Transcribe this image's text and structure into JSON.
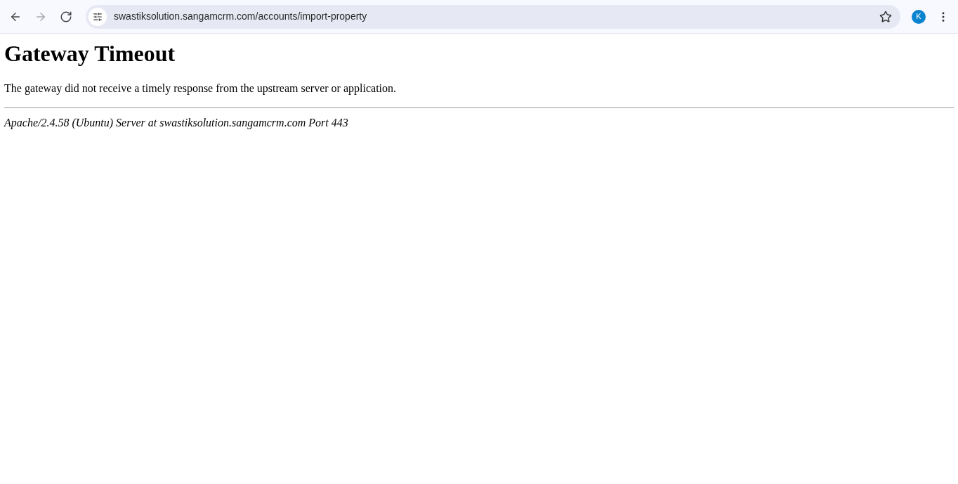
{
  "browser": {
    "nav_buttons": [
      {
        "kind": "back",
        "disabled": false
      },
      {
        "kind": "forward",
        "disabled": true
      },
      {
        "kind": "reload",
        "disabled": false
      }
    ],
    "address": "swastiksolution.sangamcrm.com/accounts/import-property",
    "profile": "K"
  },
  "page": {
    "title": "Gateway Timeout",
    "message": "The gateway did not receive a timely response from the upstream server or application.",
    "signature": "Apache/2.4.58 (Ubuntu) Server at swastiksolution.sangamcrm.com Port 443"
  }
}
